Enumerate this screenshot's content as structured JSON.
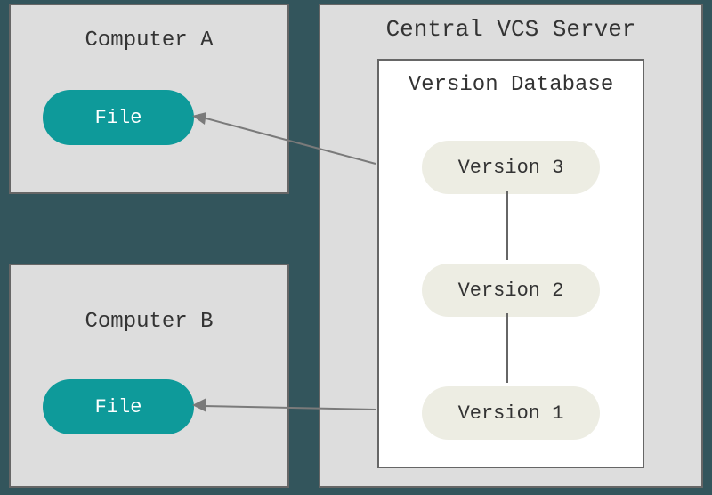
{
  "computers": [
    {
      "label": "Computer A",
      "file_label": "File"
    },
    {
      "label": "Computer B",
      "file_label": "File"
    }
  ],
  "server": {
    "title": "Central VCS Server",
    "database": {
      "title": "Version Database",
      "versions": [
        "Version 3",
        "Version 2",
        "Version 1"
      ]
    }
  }
}
